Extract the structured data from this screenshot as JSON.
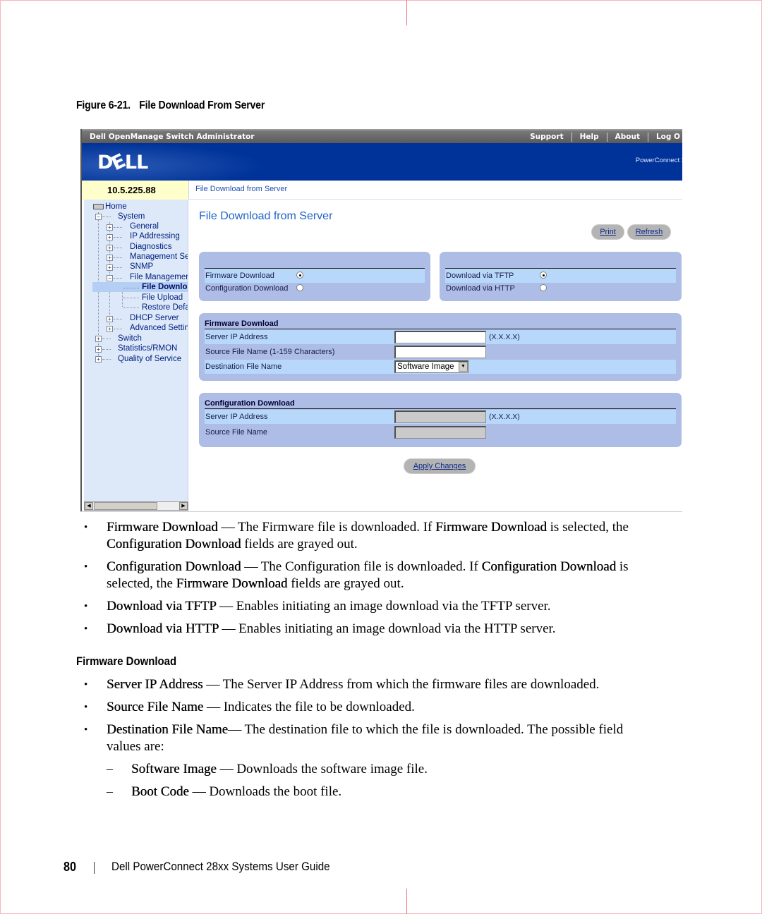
{
  "figure": {
    "number": "Figure 6-21.",
    "title": "File Download From Server"
  },
  "app": {
    "title": "Dell OpenManage Switch Administrator",
    "top_links": [
      "Support",
      "Help",
      "About",
      "Log O"
    ],
    "logo_text": [
      "D",
      "E",
      "LL"
    ],
    "product": "PowerConnect 2",
    "ip_address": "10.5.225.88",
    "breadcrumb": "File Download from Server"
  },
  "tree": {
    "items": [
      {
        "label": "Home",
        "level": 0,
        "icon": "home-icon"
      },
      {
        "label": "System",
        "level": 1,
        "expander": "minus"
      },
      {
        "label": "General",
        "level": 2,
        "expander": "plus"
      },
      {
        "label": "IP Addressing",
        "level": 2,
        "expander": "plus"
      },
      {
        "label": "Diagnostics",
        "level": 2,
        "expander": "plus"
      },
      {
        "label": "Management Se",
        "level": 2,
        "expander": "plus"
      },
      {
        "label": "SNMP",
        "level": 2,
        "expander": "plus"
      },
      {
        "label": "File Managemer",
        "level": 2,
        "expander": "minus"
      },
      {
        "label": "File Downlo",
        "level": 3,
        "selected": true
      },
      {
        "label": "File Upload",
        "level": 3
      },
      {
        "label": "Restore Defa",
        "level": 3
      },
      {
        "label": "DHCP Server",
        "level": 2,
        "expander": "plus"
      },
      {
        "label": "Advanced Settin",
        "level": 2,
        "expander": "plus"
      },
      {
        "label": "Switch",
        "level": 1,
        "expander": "plus"
      },
      {
        "label": "Statistics/RMON",
        "level": 1,
        "expander": "plus"
      },
      {
        "label": "Quality of Service",
        "level": 1,
        "expander": "plus"
      }
    ]
  },
  "main": {
    "title": "File Download from Server",
    "print_label": "Print",
    "refresh_label": "Refresh",
    "type_panel": {
      "options": [
        {
          "label": "Firmware Download",
          "selected": true
        },
        {
          "label": "Configuration Download",
          "selected": false
        }
      ]
    },
    "method_panel": {
      "options": [
        {
          "label": "Download via TFTP",
          "selected": true
        },
        {
          "label": "Download via HTTP",
          "selected": false
        }
      ]
    },
    "firmware": {
      "header": "Firmware Download",
      "server_ip_label": "Server IP Address",
      "server_ip_value": "",
      "server_ip_hint": "(X.X.X.X)",
      "source_label": "Source File Name (1-159 Characters)",
      "source_value": "",
      "dest_label": "Destination File Name",
      "dest_value": "Software Image"
    },
    "config": {
      "header": "Configuration Download",
      "server_ip_label": "Server IP Address",
      "server_ip_value": "",
      "server_ip_hint": "(X.X.X.X)",
      "source_label": "Source File Name",
      "source_value": ""
    },
    "apply_label": "Apply Changes"
  },
  "doc": {
    "bullets": [
      {
        "term": "Firmware Download",
        "sep": " — ",
        "text1": "The Firmware file is downloaded. If ",
        "term2": "Firmware Download",
        "text2": " is selected, the",
        "line2_term": "Configuration Download",
        "line2_text": " fields are grayed out."
      },
      {
        "term": "Configuration Download",
        "sep": " — ",
        "text1": "The Configuration file is downloaded. If ",
        "term2": "Configuration Download",
        "text2": " is",
        "line2_pre": "selected, the ",
        "line2_term": "Firmware Download",
        "line2_text": " fields are grayed out."
      },
      {
        "term": "Download via TFTP",
        "sep": " — ",
        "text1": "Enables initiating an image download via the TFTP server."
      },
      {
        "term": "Download via HTTP",
        "sep": " — ",
        "text1": "Enables initiating an image download via the HTTP server."
      }
    ],
    "section_title": "Firmware Download",
    "section_bullets": [
      {
        "term": "Server IP Address",
        "sep": " — ",
        "text1": "The Server IP Address from which the firmware files are downloaded."
      },
      {
        "term": "Source File Name",
        "sep": " — ",
        "text1": "Indicates the file to be downloaded."
      },
      {
        "term": "Destination File Name",
        "sep": "— ",
        "text1": "The destination file to which the file is downloaded. The possible field",
        "line2_text": "values are:"
      }
    ],
    "sub_items": [
      {
        "term": "Software Image",
        "sep": " — ",
        "text1": "Downloads the software image file."
      },
      {
        "term": "Boot Code",
        "sep": " — ",
        "text1": "Downloads the boot file."
      }
    ],
    "bullet_glyph": "•",
    "dash_glyph": "–"
  },
  "footer": {
    "page_number": "80",
    "guide_title": "Dell PowerConnect 28xx Systems User Guide"
  }
}
